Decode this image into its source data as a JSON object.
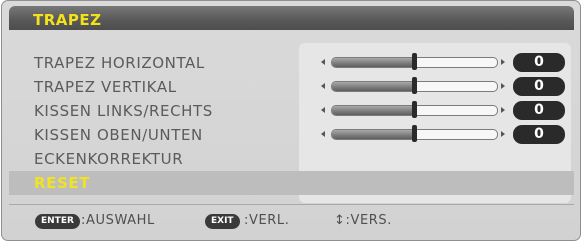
{
  "menu": {
    "title": "TRAPEZ",
    "items": [
      {
        "label": "TRAPEZ HORIZONTAL",
        "value": "0",
        "slider_position": 0.5
      },
      {
        "label": "TRAPEZ VERTIKAL",
        "value": "0",
        "slider_position": 0.5
      },
      {
        "label": "KISSEN LINKS/RECHTS",
        "value": "0",
        "slider_position": 0.5
      },
      {
        "label": "KISSEN OBEN/UNTEN",
        "value": "0",
        "slider_position": 0.5
      },
      {
        "label": "ECKENKORREKTUR"
      },
      {
        "label": "RESET",
        "selected": true
      }
    ]
  },
  "footer": {
    "enter_key": "ENTER",
    "enter_hint": ":AUSWAHL",
    "exit_key": "EXIT",
    "exit_hint": ":VERL.",
    "nav_hint": "↕:VERS."
  },
  "colors": {
    "title": "#f3e21b",
    "selected_text": "#f1e222",
    "selected_row": "#bdbdbd",
    "value_box": "#2a2a2a"
  },
  "icons": {
    "slider_left": "triangle-left-icon",
    "slider_right": "triangle-right-icon",
    "nav": "up-down-arrow-icon"
  }
}
